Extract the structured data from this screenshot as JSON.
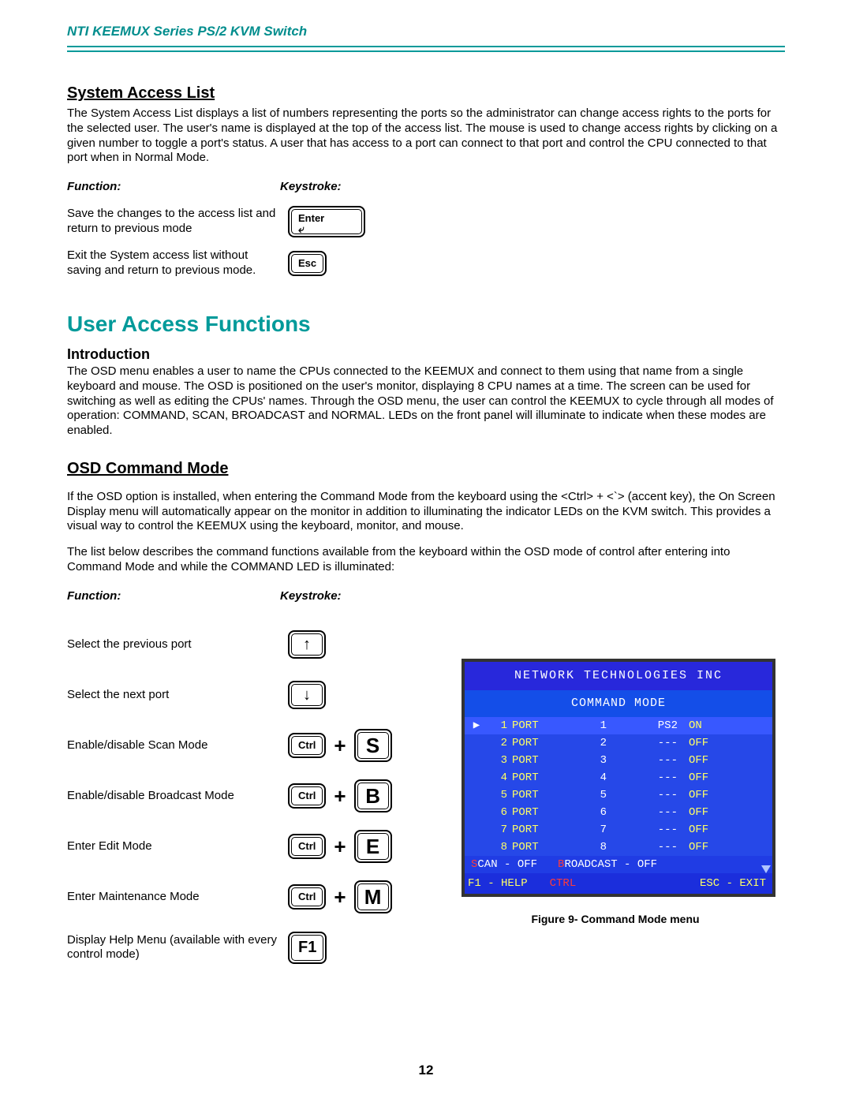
{
  "header": {
    "title": "NTI KEEMUX Series   PS/2 KVM Switch"
  },
  "sal": {
    "heading": "System Access List",
    "para": "The System Access List displays a list of numbers representing the ports so the administrator can change access rights to the ports for the selected user.  The user's name is displayed at the top of the access list.  The mouse is used to change access rights by clicking on a given number to toggle a port's status.   A user that has access to a port can connect to that port and control the CPU connected to that port when in Normal Mode.",
    "func_label": "Function:",
    "key_label": "Keystroke:",
    "row1": "Save the changes to the access list and return to previous mode",
    "row2": "Exit the System access list without saving and return to previous mode.",
    "enter": "Enter",
    "esc": "Esc"
  },
  "uaf": {
    "heading": "User Access Functions",
    "intro_h": "Introduction",
    "intro_p": "The OSD menu enables a user to name the CPUs connected to the KEEMUX and connect to them using that name from a single keyboard and mouse.  The OSD is positioned on the user's monitor, displaying 8 CPU names at a time.  The screen can be used for switching as well as editing the CPUs' names. Through the OSD menu,  the user can control the KEEMUX to cycle through all modes of operation:  COMMAND,  SCAN, BROADCAST and NORMAL.   LEDs on the front panel will illuminate to indicate when these modes are enabled."
  },
  "ocm": {
    "heading": "OSD Command Mode",
    "p1": "If the OSD option is installed, when entering the Command Mode from the keyboard using the  <Ctrl> + <`> (accent key), the On Screen Display menu will automatically appear on the monitor in addition to illuminating the indicator LEDs on the KVM switch.    This provides a visual way to control the KEEMUX using the keyboard, monitor, and mouse.",
    "p2": "The list below describes the command functions available from the keyboard within the OSD mode of control after entering into Command Mode and while the COMMAND LED is illuminated:",
    "func_label": "Function:",
    "key_label": "Keystroke:",
    "rows": {
      "r1": "Select the previous port",
      "r2": "Select the next port",
      "r3": "Enable/disable Scan Mode",
      "r4": "Enable/disable Broadcast Mode",
      "r5": "Enter Edit Mode",
      "r6": "Enter Maintenance Mode",
      "r7": "Display Help Menu (available with every control mode)"
    },
    "keys": {
      "ctrl": "Ctrl",
      "s": "S",
      "b": "B",
      "e": "E",
      "m": "M",
      "f1": "F1",
      "plus": "+"
    }
  },
  "shot": {
    "title": "NETWORK  TECHNOLOGIES  INC",
    "subtitle": "COMMAND MODE",
    "rows": [
      {
        "n": "1",
        "port": "PORT",
        "name": "1",
        "ps": "PS2",
        "on": "ON"
      },
      {
        "n": "2",
        "port": "PORT",
        "name": "2",
        "ps": "---",
        "on": "OFF"
      },
      {
        "n": "3",
        "port": "PORT",
        "name": "3",
        "ps": "---",
        "on": "OFF"
      },
      {
        "n": "4",
        "port": "PORT",
        "name": "4",
        "ps": "---",
        "on": "OFF"
      },
      {
        "n": "5",
        "port": "PORT",
        "name": "5",
        "ps": "---",
        "on": "OFF"
      },
      {
        "n": "6",
        "port": "PORT",
        "name": "6",
        "ps": "---",
        "on": "OFF"
      },
      {
        "n": "7",
        "port": "PORT",
        "name": "7",
        "ps": "---",
        "on": "OFF"
      },
      {
        "n": "8",
        "port": "PORT",
        "name": "8",
        "ps": "---",
        "on": "OFF"
      }
    ],
    "status": {
      "scan_s": "S",
      "scan_rest": "CAN - OFF",
      "bcast_b": "B",
      "bcast_rest": "ROADCAST - OFF"
    },
    "help": {
      "f1": "F1  - HELP",
      "ctrl": "CTRL",
      "esc": "ESC - EXIT"
    },
    "caption": "Figure 9- Command Mode menu"
  },
  "pagenum": "12"
}
